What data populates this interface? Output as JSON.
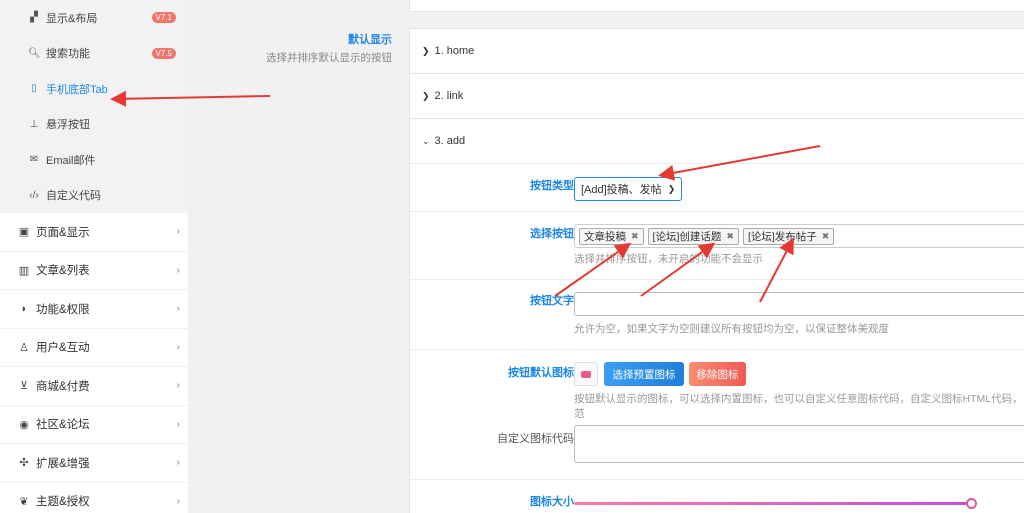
{
  "sidebar": {
    "sub_items": [
      {
        "label": "显示&布局",
        "icon": "layout-icon",
        "badge": "V7.1"
      },
      {
        "label": "搜索功能",
        "icon": "search-icon",
        "badge": "V7.5"
      },
      {
        "label": "手机底部Tab",
        "icon": "mobile-icon",
        "badge": "",
        "active": true
      },
      {
        "label": "悬浮按钮",
        "icon": "pin-icon",
        "badge": ""
      },
      {
        "label": "Email邮件",
        "icon": "mail-icon",
        "badge": ""
      },
      {
        "label": "自定义代码",
        "icon": "code-icon",
        "badge": ""
      }
    ],
    "main_items": [
      {
        "label": "页面&显示",
        "icon": "calendar-icon"
      },
      {
        "label": "文章&列表",
        "icon": "map-icon"
      },
      {
        "label": "功能&权限",
        "icon": "shield-icon"
      },
      {
        "label": "用户&互动",
        "icon": "user-icon"
      },
      {
        "label": "商城&付费",
        "icon": "cart-icon"
      },
      {
        "label": "社区&论坛",
        "icon": "compass-icon"
      },
      {
        "label": "扩展&增强",
        "icon": "puzzle-icon"
      },
      {
        "label": "主题&授权",
        "icon": "theme-icon"
      }
    ]
  },
  "section": {
    "title": "默认显示",
    "desc": "选择并排序默认显示的按钮"
  },
  "accordion": [
    {
      "label": "1. home",
      "expanded": false
    },
    {
      "label": "2. link",
      "expanded": false
    },
    {
      "label": "3. add",
      "expanded": true
    }
  ],
  "form": {
    "button_type": {
      "label": "按钮类型",
      "value": "[Add]投稿、发帖"
    },
    "select_buttons": {
      "label": "选择按钮",
      "tags": [
        "文章投稿",
        "[论坛]创建话题",
        "[论坛]发布帖子"
      ],
      "tag_remove": "✖",
      "hint": "选择并排序按钮，未开启的功能不会显示"
    },
    "button_text": {
      "label": "按钮文字",
      "value": "",
      "hint": "允许为空，如果文字为空则建议所有按钮均为空，以保证整体美观度"
    },
    "default_icon": {
      "label": "按钮默认图标",
      "choose_button": "选择预置图标",
      "remove_button": "移除图标",
      "hint_line1": "按钮默认显示的图标，可以选择内置图标，也可以自定义任意图标代码，自定义图标HTML代码，",
      "hint_line2": "范",
      "custom_label": "自定义图标代码"
    },
    "icon_size": {
      "label": "图标大小",
      "value_fraction": 0.98
    }
  },
  "colors": {
    "accent": "#1e88e5",
    "badge": "#f0766a",
    "arrow": "#e53935"
  }
}
